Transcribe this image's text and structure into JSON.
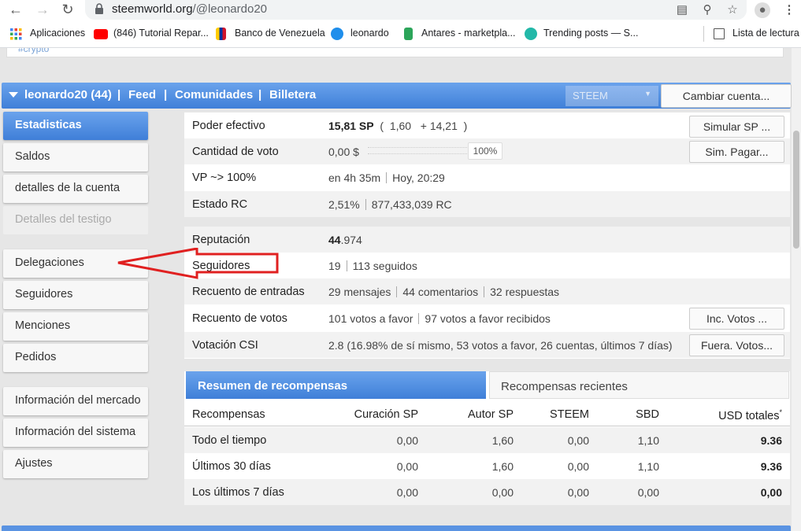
{
  "browser": {
    "url_host": "steemworld.org",
    "url_path": "/@leonardo20",
    "bookmarks": [
      {
        "label": "Aplicaciones",
        "color": "#4285f4"
      },
      {
        "label": "(846) Tutorial Repar...",
        "color": "#ff0000"
      },
      {
        "label": "Banco de Venezuela",
        "color": "#ffcc00"
      },
      {
        "label": "leonardo",
        "color": "#1f8eeb"
      },
      {
        "label": "Antares - marketpla...",
        "color": "#2ca55a"
      },
      {
        "label": "Trending posts — S...",
        "color": "#22b8a8"
      }
    ],
    "reading_list": "Lista de lectura",
    "prev_text": "#crypto"
  },
  "topbar": {
    "account": "leonardo20 (44)",
    "feed": "Feed",
    "communities": "Comunidades",
    "wallet": "Billetera",
    "sep": "|",
    "currency": "STEEM",
    "switch_account": "Cambiar cuenta..."
  },
  "sidebar": {
    "items": [
      {
        "label": "Estadisticas"
      },
      {
        "label": "Saldos"
      },
      {
        "label": "detalles de la cuenta"
      },
      {
        "label": "Detalles del testigo"
      },
      {
        "label": "Delegaciones"
      },
      {
        "label": "Seguidores"
      },
      {
        "label": "Menciones"
      },
      {
        "label": "Pedidos"
      },
      {
        "label": "Información del mercado"
      },
      {
        "label": "Información del sistema"
      },
      {
        "label": "Ajustes"
      }
    ]
  },
  "stats": {
    "effective_power": {
      "label": "Poder efectivo",
      "value": "15,81 SP",
      "detail1": "1,60",
      "detail2": "+ 14,21",
      "open": "(",
      "close": ")",
      "button": "Simular SP ..."
    },
    "vote_amount": {
      "label": "Cantidad de voto",
      "value": "0,00 $",
      "percent": "100%",
      "button": "Sim. Pagar..."
    },
    "vp": {
      "label": "VP ~> 100%",
      "value1": "en 4h 35m",
      "value2": "Hoy, 20:29"
    },
    "rc": {
      "label": "Estado RC",
      "value1": "2,51%",
      "value2": "877,433,039 RC"
    },
    "reputation": {
      "label": "Reputación",
      "value_main": "44",
      "value_dec": ".974"
    },
    "followers": {
      "label": "Seguidores",
      "value1": "19",
      "value2": "113 seguidos"
    },
    "posts": {
      "label": "Recuento de entradas",
      "value1": "29 mensajes",
      "value2": "44 comentarios",
      "value3": "32 respuestas"
    },
    "votes": {
      "label": "Recuento de votos",
      "value1": "101 votos a favor",
      "value2": "97 votos a favor recibidos",
      "button": "Inc. Votos ..."
    },
    "csi": {
      "label": "Votación CSI",
      "value": "2.8 (16.98% de sí mismo, 53 votos a favor, 26 cuentas, últimos 7 días)",
      "button": "Fuera. Votos..."
    }
  },
  "rewards": {
    "tab_active": "Resumen de recompensas",
    "tab_inactive": "Recompensas recientes",
    "headers": [
      "Recompensas",
      "Curación SP",
      "Autor SP",
      "STEEM",
      "SBD",
      "USD totales"
    ],
    "total_mark": "*",
    "rows": [
      {
        "label": "Todo el tiempo",
        "values": [
          "0,00",
          "1,60",
          "0,00",
          "1,10"
        ],
        "total": "9.36"
      },
      {
        "label": "Últimos 30 días",
        "values": [
          "0,00",
          "1,60",
          "0,00",
          "1,10"
        ],
        "total": "9.36"
      },
      {
        "label": "Los últimos 7 días",
        "values": [
          "0,00",
          "0,00",
          "0,00",
          "0,00"
        ],
        "total": "0,00"
      }
    ]
  },
  "colors": {
    "accent": "#3f7fd8",
    "arrow": "#e02020"
  }
}
